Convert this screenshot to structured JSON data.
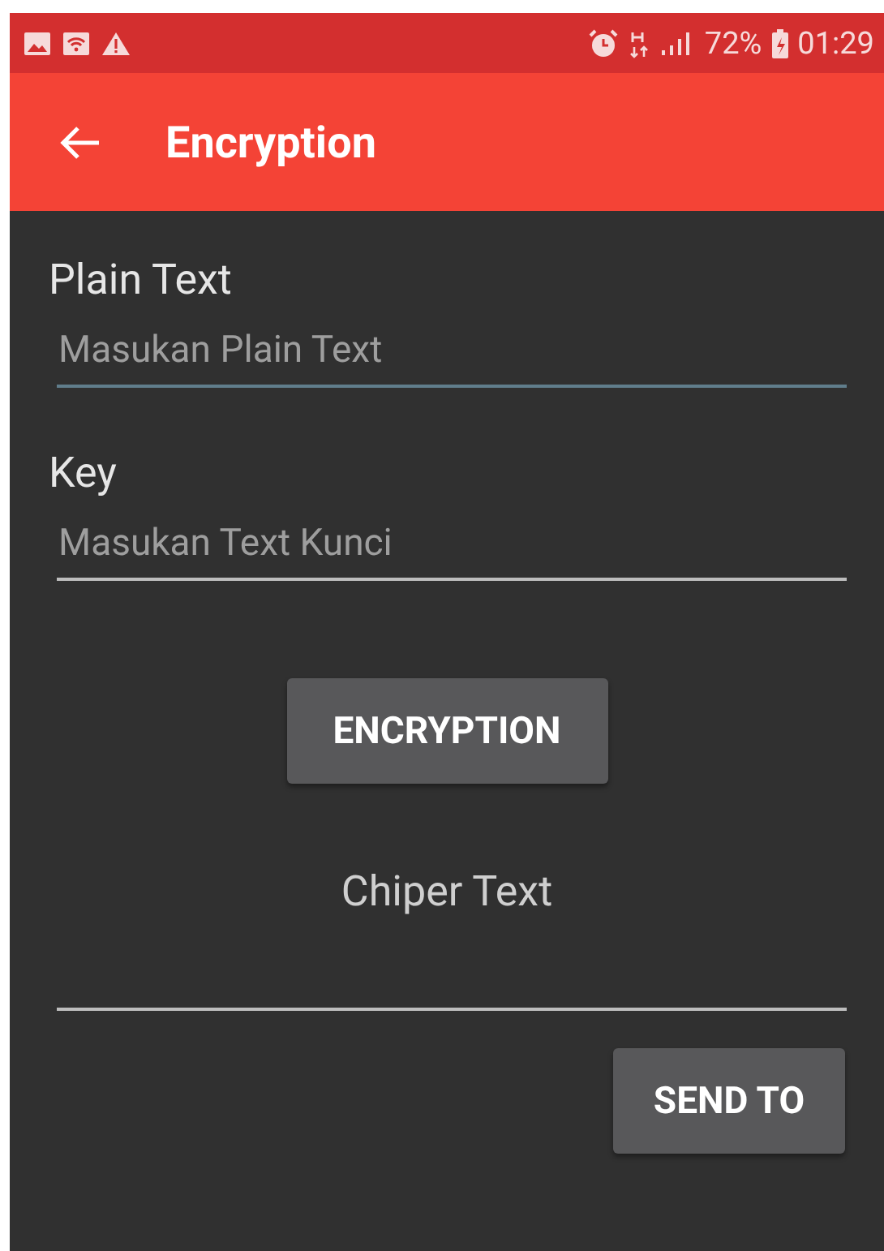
{
  "status_bar": {
    "battery": "72%",
    "time": "01:29"
  },
  "app_bar": {
    "title": "Encryption"
  },
  "fields": [
    {
      "label": "Plain Text",
      "placeholder": "Masukan Plain Text",
      "focused": true
    },
    {
      "label": "Key",
      "placeholder": "Masukan Text Kunci",
      "focused": false
    }
  ],
  "encrypt_button": "ENCRYPTION",
  "output": {
    "label": "Chiper Text"
  },
  "send_button": "SEND TO"
}
